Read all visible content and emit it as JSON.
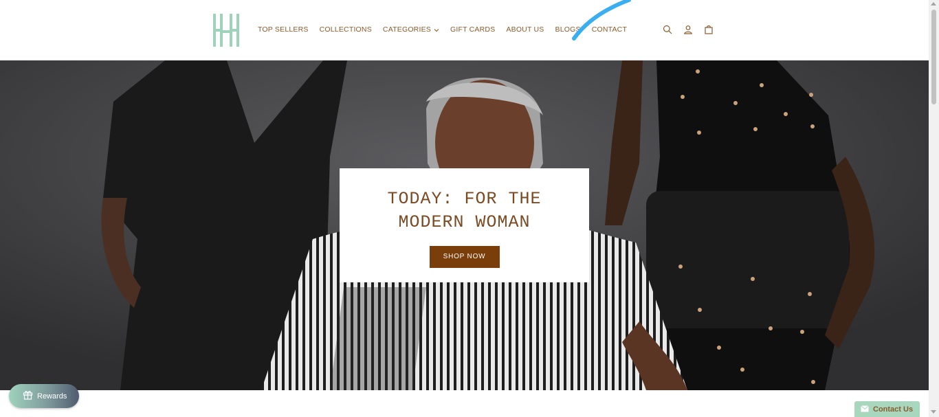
{
  "header": {
    "nav": [
      {
        "label": "TOP SELLERS"
      },
      {
        "label": "COLLECTIONS"
      },
      {
        "label": "CATEGORIES",
        "has_dropdown": true
      },
      {
        "label": "GIFT CARDS"
      },
      {
        "label": "ABOUT US"
      },
      {
        "label": "BLOGS"
      },
      {
        "label": "CONTACT"
      }
    ],
    "icons": [
      "search-icon",
      "account-icon",
      "cart-icon"
    ],
    "logo_color": "#9fd2bb",
    "nav_color": "#8a5a2b"
  },
  "hero": {
    "title_line1": "TODAY: FOR THE",
    "title_line2": "MODERN WOMAN",
    "button_label": "SHOP NOW",
    "button_color": "#7a3e0b",
    "title_color": "#7a4a23"
  },
  "widgets": {
    "rewards_label": "Rewards",
    "contact_label": "Contact Us",
    "contact_color": "#a8d7be"
  },
  "colors": {
    "stroke_blue": "#3aaef0"
  }
}
